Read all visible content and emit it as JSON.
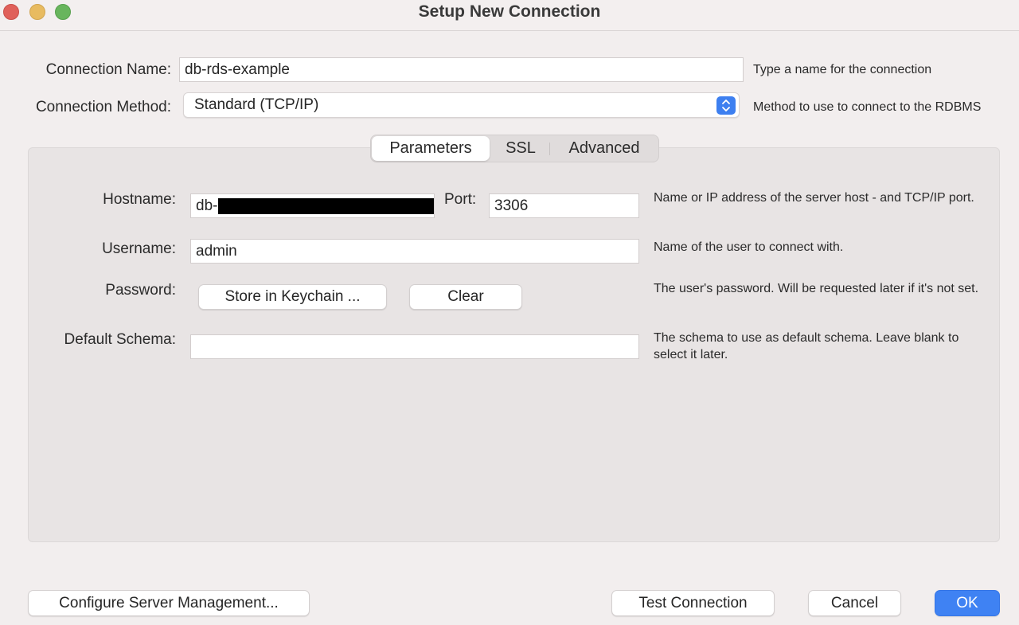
{
  "window": {
    "title": "Setup New Connection"
  },
  "connection_name": {
    "label": "Connection Name:",
    "value": "db-rds-example",
    "help": "Type a name for the connection"
  },
  "connection_method": {
    "label": "Connection Method:",
    "value": "Standard (TCP/IP)",
    "help": "Method to use to connect to the RDBMS"
  },
  "tabs": [
    {
      "label": "Parameters",
      "active": true
    },
    {
      "label": "SSL",
      "active": false
    },
    {
      "label": "Advanced",
      "active": false
    }
  ],
  "parameters": {
    "hostname": {
      "label": "Hostname:",
      "value_prefix": "db-",
      "redacted": true
    },
    "port": {
      "label": "Port:",
      "value": "3306"
    },
    "hostname_help": "Name or IP address of the server host - and TCP/IP port.",
    "username": {
      "label": "Username:",
      "value": "admin",
      "help": "Name of the user to connect with."
    },
    "password": {
      "label": "Password:",
      "store_button": "Store in Keychain ...",
      "clear_button": "Clear",
      "help": "The user's password. Will be requested later if it's not set."
    },
    "default_schema": {
      "label": "Default Schema:",
      "value": "",
      "help": "The schema to use as default schema. Leave blank to select it later."
    }
  },
  "footer": {
    "configure_button": "Configure Server Management...",
    "test_button": "Test Connection",
    "cancel_button": "Cancel",
    "ok_button": "OK"
  },
  "colors": {
    "accent": "#3f82f3",
    "panel": "#e8e4e4",
    "window": "#f2eeee"
  }
}
